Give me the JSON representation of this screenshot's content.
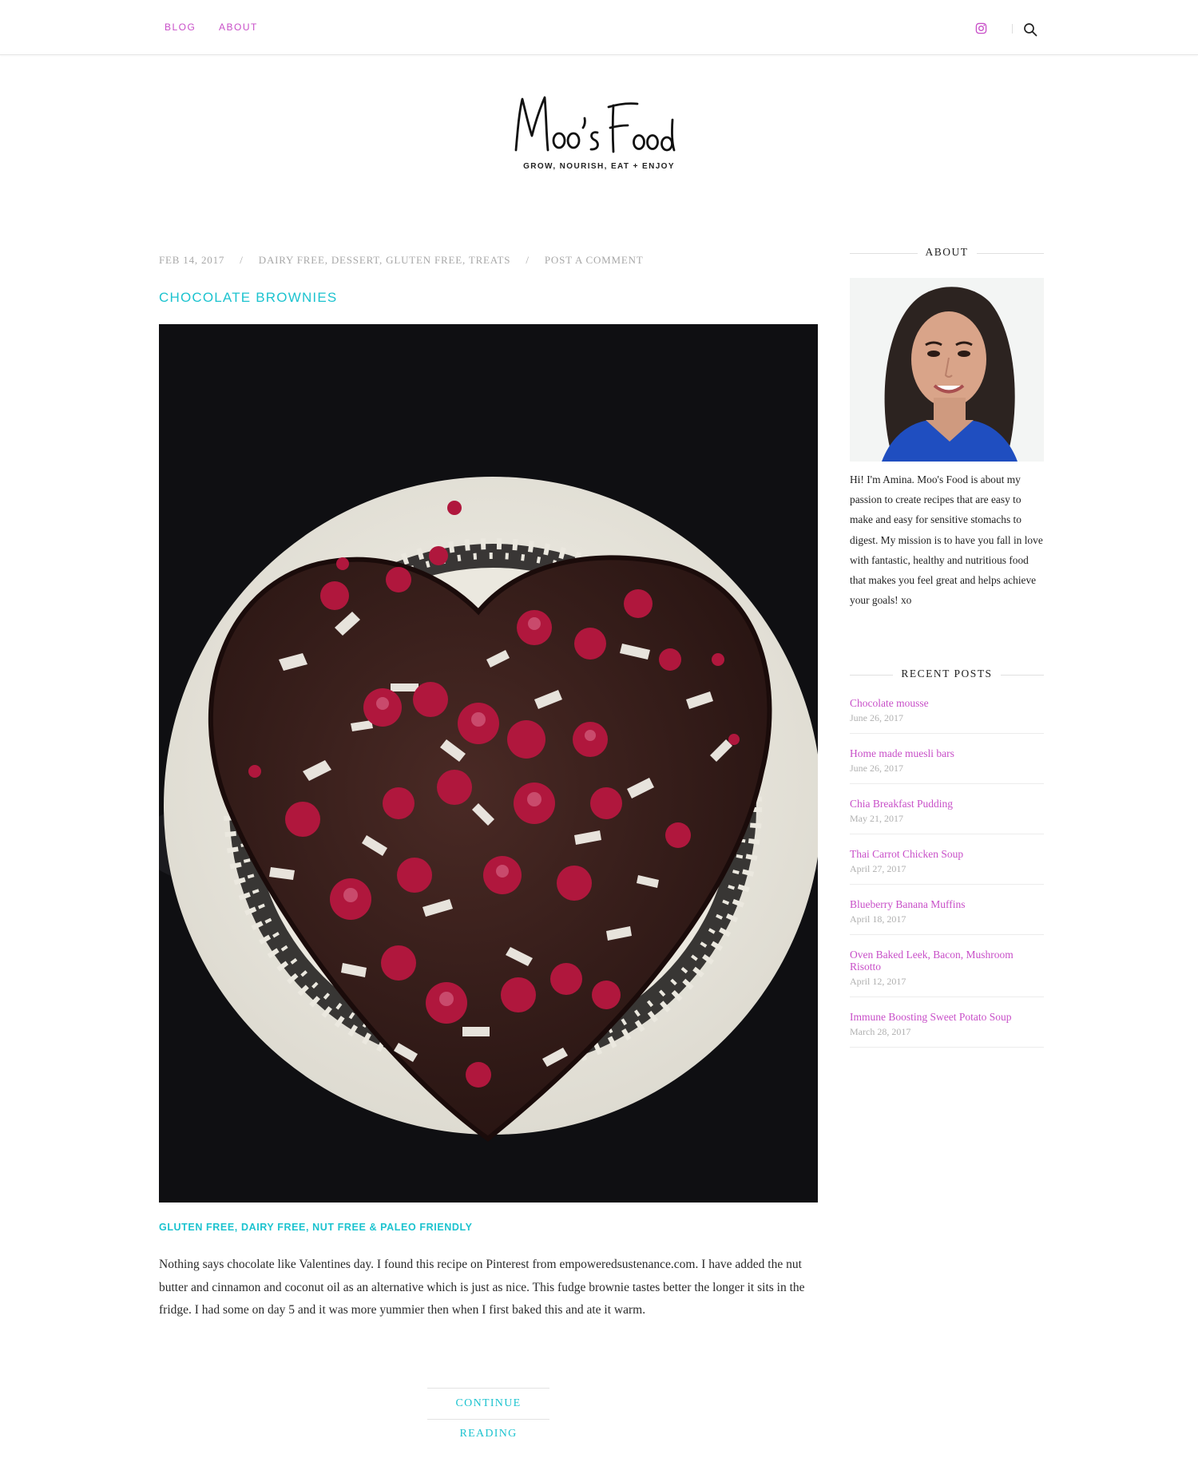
{
  "nav": {
    "links": [
      "BLOG",
      "ABOUT"
    ],
    "instagram_icon": "instagram-icon",
    "search_icon": "search-icon",
    "accent": "#c84fc8"
  },
  "brand": {
    "logo_text": "Moo's Food",
    "tagline": "GROW, NOURISH, EAT + ENJOY"
  },
  "post": {
    "date": "FEB 14, 2017",
    "categories": "DAIRY FREE, DESSERT, GLUTEN FREE, TREATS",
    "comment_link": "POST A COMMENT",
    "title": "CHOCOLATE BROWNIES",
    "subheading": "GLUTEN FREE, DAIRY FREE, NUT FREE & PALEO FRIENDLY",
    "excerpt": "Nothing says chocolate like Valentines day. I found this recipe on Pinterest from empoweredsustenance.com.  I have added the nut butter and cinnamon and coconut oil as an alternative which is just as nice. This fudge brownie tastes better the longer it sits in the fridge. I had some on day 5 and it was more yummier then when I first baked this and ate it warm.",
    "continue_label": "CONTINUE READING",
    "title_color": "#1cc3cf"
  },
  "sidebar": {
    "about_heading": "ABOUT",
    "about_text": "Hi! I'm Amina. Moo's Food is about my passion to create recipes that are easy to make and easy for sensitive stomachs to digest. My mission is to have you fall in love with fantastic, healthy and nutritious food that makes you feel great and helps achieve your goals! xo",
    "recent_heading": "RECENT POSTS",
    "recent_posts": [
      {
        "title": "Chocolate mousse",
        "date": "June 26, 2017"
      },
      {
        "title": "Home made muesli bars",
        "date": "June 26, 2017"
      },
      {
        "title": "Chia Breakfast Pudding",
        "date": "May 21, 2017"
      },
      {
        "title": "Thai Carrot Chicken Soup",
        "date": "April 27, 2017"
      },
      {
        "title": "Blueberry Banana Muffins",
        "date": "April 18, 2017"
      },
      {
        "title": "Oven Baked Leek, Bacon, Mushroom Risotto",
        "date": "April 12, 2017"
      },
      {
        "title": "Immune Boosting Sweet Potato Soup",
        "date": "March 28, 2017"
      }
    ]
  }
}
